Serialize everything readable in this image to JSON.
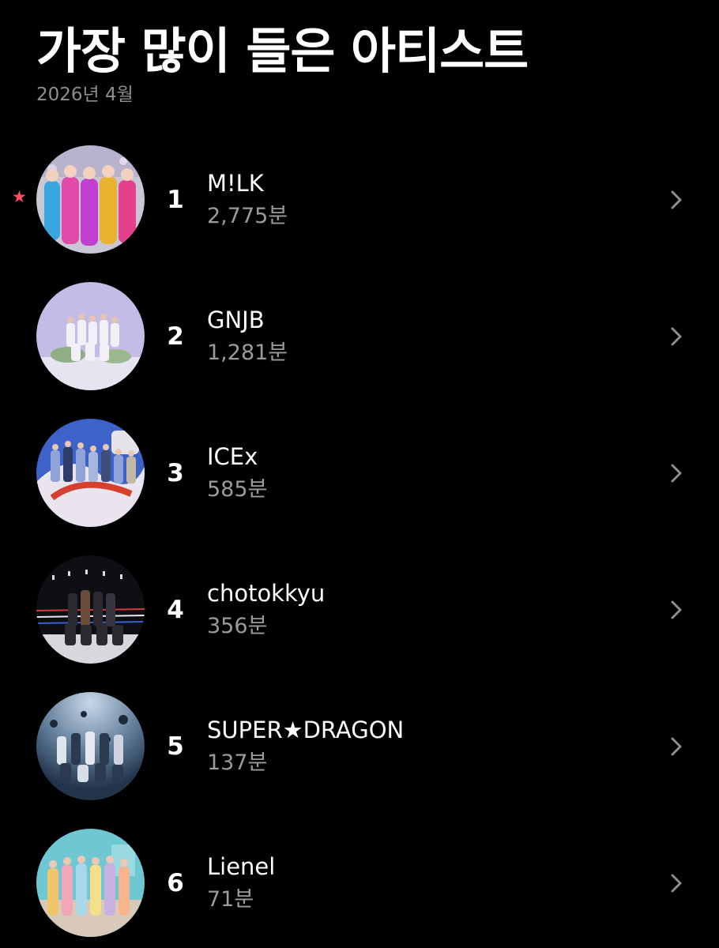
{
  "header": {
    "title": "가장 많이 들은 아티스트",
    "period": "2026년 4월"
  },
  "colors": {
    "background": "#000000",
    "secondary_text": "#9a9a9f",
    "star": "#ff4d6a"
  },
  "artists": [
    {
      "rank": "1",
      "name": "M!LK",
      "minutes": "2,775분",
      "starred": true,
      "icon": "star-icon"
    },
    {
      "rank": "2",
      "name": "GNJB",
      "minutes": "1,281분",
      "starred": false
    },
    {
      "rank": "3",
      "name": "ICEx",
      "minutes": "585분",
      "starred": false
    },
    {
      "rank": "4",
      "name": "chotokkyu",
      "minutes": "356분",
      "starred": false
    },
    {
      "rank": "5",
      "name": "SUPER★DRAGON",
      "minutes": "137분",
      "starred": false
    },
    {
      "rank": "6",
      "name": "Lienel",
      "minutes": "71분",
      "starred": false
    }
  ]
}
